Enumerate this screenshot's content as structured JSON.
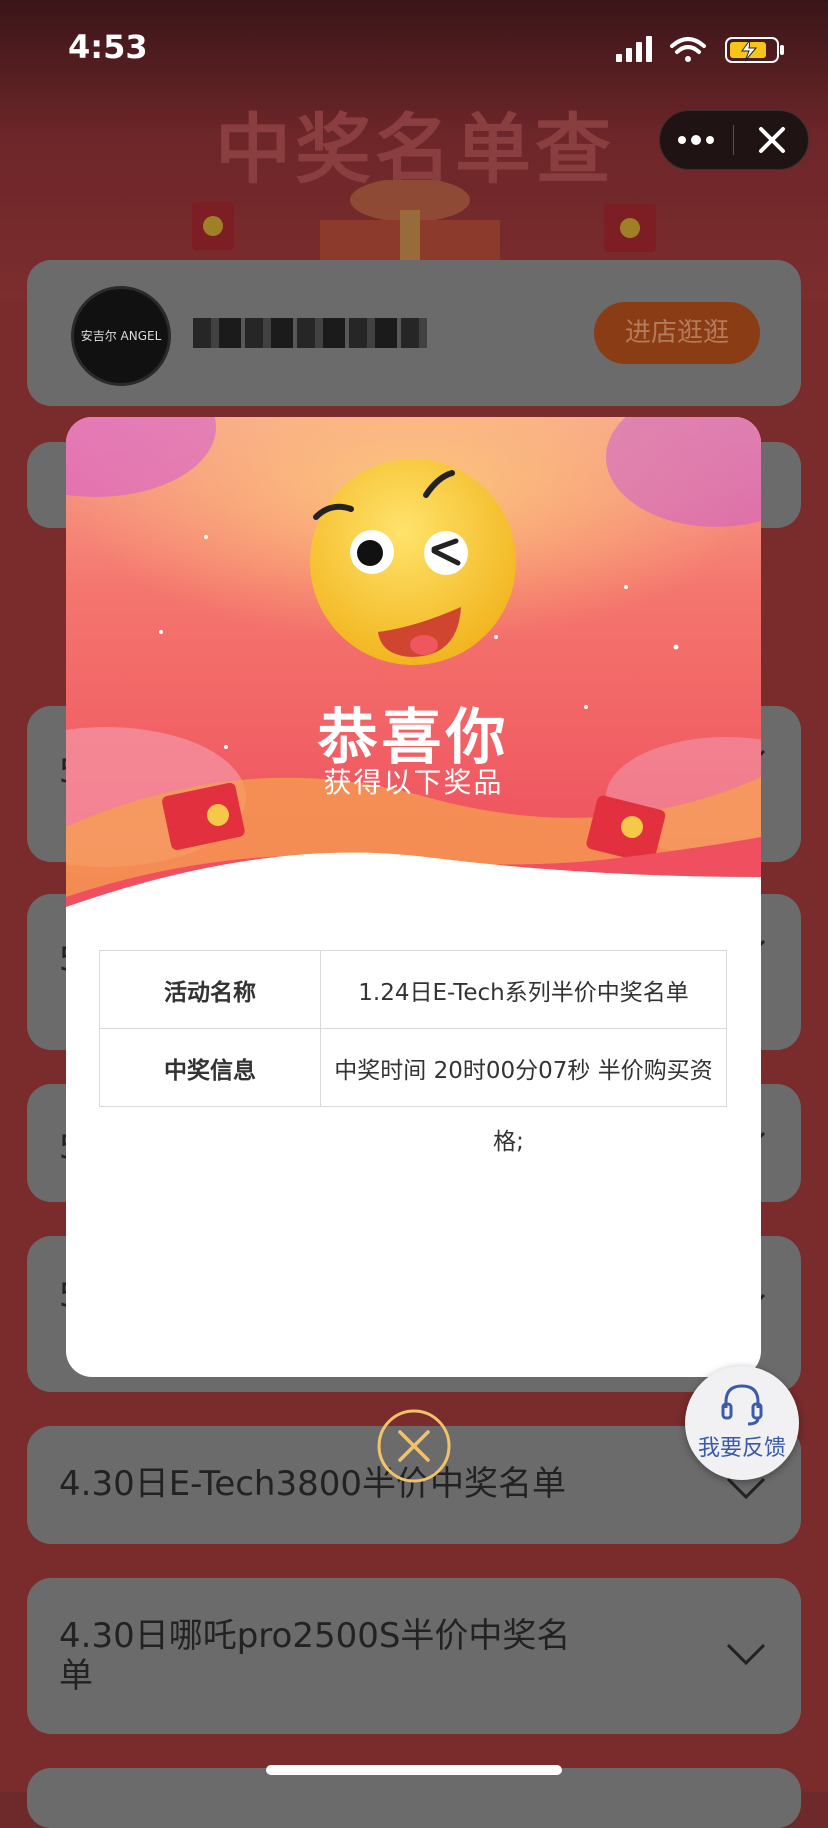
{
  "status_bar": {
    "time": "4:53"
  },
  "header": {
    "title": "中奖名单查询"
  },
  "shop": {
    "logo_text": "安吉尔 ANGEL",
    "button_label": "进店逛逛"
  },
  "list": {
    "partial_3": "5",
    "partial_4": "5",
    "partial_5": "5",
    "partial_6": "5",
    "row_7": "4.30日E-Tech3800半价中奖名单",
    "row_8_line1": "4.30日哪吒pro2500S半价中奖名",
    "row_8_line2": "单"
  },
  "modal": {
    "title": "恭喜你",
    "subtitle": "获得以下奖品",
    "rows": [
      {
        "key": "活动名称",
        "value": "1.24日E-Tech系列半价中奖名单"
      },
      {
        "key": "中奖信息",
        "value": "中奖时间 20时00分07秒 半价购买资"
      }
    ],
    "wrap_tail": "格;"
  },
  "feedback": {
    "label": "我要反馈"
  },
  "colors": {
    "accent_orange": "#8a3c15",
    "hero_red": "#ef4f5e",
    "hero_pink": "#f36d76"
  }
}
